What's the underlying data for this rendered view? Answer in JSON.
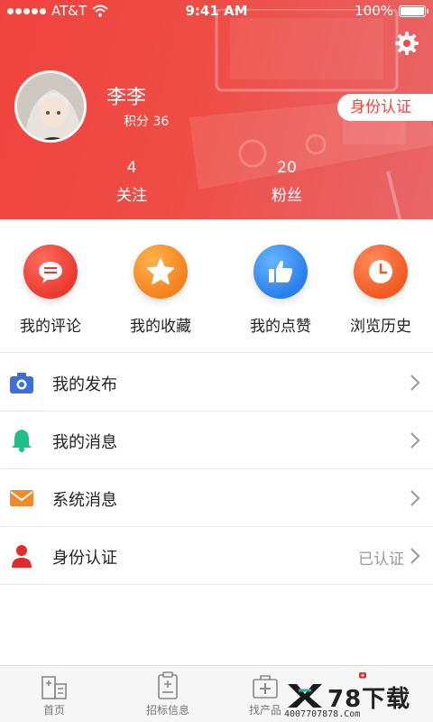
{
  "status_bar": {
    "carrier": "AT&T",
    "time": "9:41 AM",
    "battery": "100%"
  },
  "profile": {
    "name": "李李",
    "points_label": "积分 36",
    "verify_button": "身份认证",
    "stats": [
      {
        "value": "4",
        "label": "关注"
      },
      {
        "value": "20",
        "label": "粉丝"
      }
    ]
  },
  "quick_actions": [
    {
      "label": "我的评论",
      "icon": "comment-icon",
      "color": "#ea3a30"
    },
    {
      "label": "我的收藏",
      "icon": "star-icon",
      "color": "#f5821f"
    },
    {
      "label": "我的点赞",
      "icon": "thumbs-up-icon",
      "color": "#2b7fec"
    },
    {
      "label": "浏览历史",
      "icon": "clock-icon",
      "color": "#f25a22"
    }
  ],
  "menu": [
    {
      "label": "我的发布",
      "icon": "camera-icon",
      "color": "#3e6fd8",
      "extra": ""
    },
    {
      "label": "我的消息",
      "icon": "bell-icon",
      "color": "#1fc08a",
      "extra": ""
    },
    {
      "label": "系统消息",
      "icon": "mail-icon",
      "color": "#f0892a",
      "extra": ""
    },
    {
      "label": "身份认证",
      "icon": "person-icon",
      "color": "#e22b2b",
      "extra": "已认证"
    }
  ],
  "tabbar": [
    {
      "label": "首页",
      "icon": "building-icon"
    },
    {
      "label": "招标信息",
      "icon": "clipboard-icon"
    },
    {
      "label": "找产品",
      "icon": "medical-kit-icon"
    },
    {
      "label": "",
      "icon": "profile-icon",
      "color": "#e22b2b"
    }
  ],
  "watermark": {
    "brand": "78下载",
    "url": "4007707878.Com"
  }
}
